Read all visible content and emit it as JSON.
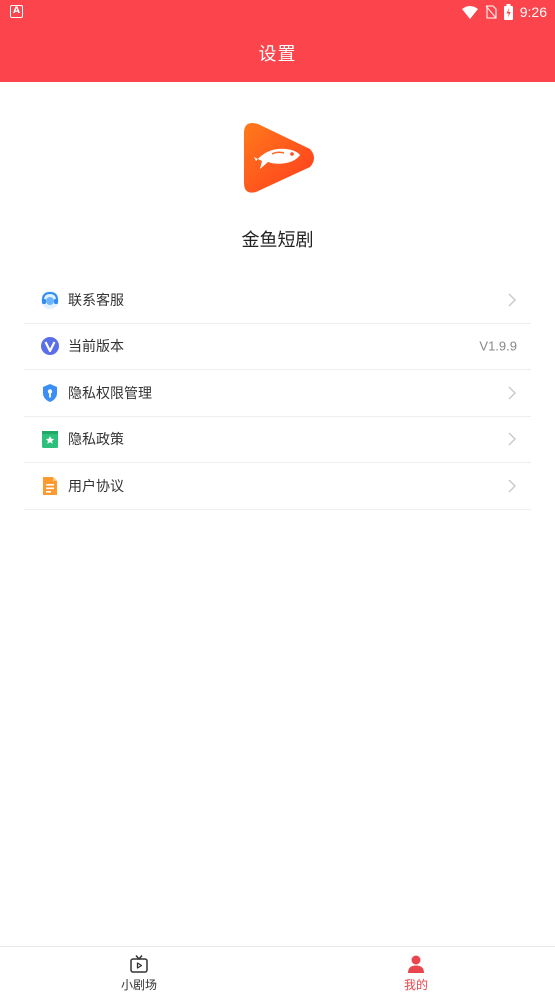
{
  "status_bar": {
    "time": "9:26",
    "notification_badge": "A"
  },
  "header": {
    "title": "设置"
  },
  "app": {
    "name": "金鱼短剧"
  },
  "menu": {
    "items": [
      {
        "label": "联系客服",
        "icon": "customer-service-icon",
        "value": ""
      },
      {
        "label": "当前版本",
        "icon": "version-icon",
        "value": "V1.9.9"
      },
      {
        "label": "隐私权限管理",
        "icon": "privacy-shield-icon",
        "value": ""
      },
      {
        "label": "隐私政策",
        "icon": "privacy-policy-icon",
        "value": ""
      },
      {
        "label": "用户协议",
        "icon": "user-agreement-icon",
        "value": ""
      }
    ]
  },
  "tabbar": {
    "tabs": [
      {
        "label": "小剧场",
        "icon": "theater-tv-icon",
        "active": false
      },
      {
        "label": "我的",
        "icon": "profile-icon",
        "active": true
      }
    ]
  },
  "colors": {
    "brand": "#fb444b",
    "tab_active": "#e8454c",
    "tab_inactive": "#333333"
  }
}
